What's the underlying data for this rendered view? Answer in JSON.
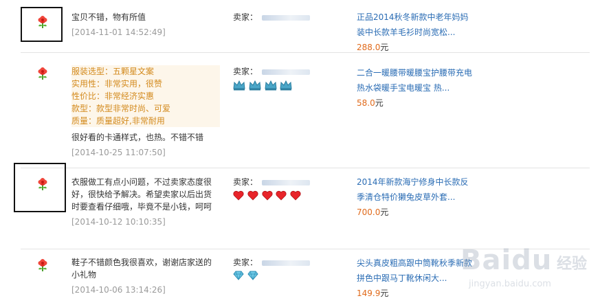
{
  "reviews": [
    {
      "rating_icon": "flower-icon",
      "comment": "宝贝不错，物有所值",
      "date": "[2014-11-01 14:52:49]",
      "seller_label": "卖家：",
      "badges": [],
      "product_title": "正品2014秋冬新款中老年妈妈装中长款羊毛衫时尚宽松...",
      "price": "288.0",
      "currency": "元"
    },
    {
      "rating_icon": "flower-icon",
      "attributes": [
        "服装选型：五颗星文案",
        "实用性：非常实用，很赞",
        "性价比：非常经济实惠",
        "款型：款型非常时尚、可爱",
        "质量：质量超好,非常耐用"
      ],
      "comment": "很好看的卡通样式，也热。不错不错",
      "date": "[2014-10-25 11:07:50]",
      "seller_label": "卖家：",
      "badge_type": "crown-icon",
      "badges": [
        "crown",
        "crown",
        "crown",
        "crown"
      ],
      "product_title": "二合一暖腰带暖腰宝护腰带充电热水袋暖手宝电暖宝 热...",
      "price": "58.0",
      "currency": "元"
    },
    {
      "rating_icon": "flower-icon",
      "comment": "衣服做工有点小问题，不过卖家态度很好，很快给予解决。希望卖家以后出货时要查看仔细哦，毕竟不是小钱，呵呵",
      "date": "[2014-10-12 10:10:35]",
      "seller_label": "卖家：",
      "badge_type": "heart-icon",
      "badges": [
        "heart",
        "heart",
        "heart",
        "heart",
        "heart"
      ],
      "product_title": "2014年新款海宁修身中长款反季清仓特价獭兔皮草外套...",
      "price": "700.0",
      "currency": "元"
    },
    {
      "rating_icon": "flower-icon",
      "comment": "鞋子不错颜色我很喜欢，谢谢店家送的小礼物",
      "date": "[2014-10-06 13:14:26]",
      "seller_label": "卖家：",
      "badge_type": "diamond-icon",
      "badges": [
        "diamond",
        "diamond"
      ],
      "product_title": "尖头真皮粗高跟中筒靴秋季新款拼色中跟马丁靴休闲大...",
      "price": "149.9",
      "currency": "元"
    }
  ],
  "watermark": {
    "logo": "Baidu",
    "cn": "经验",
    "url": "jingyan.baidu.com"
  },
  "colors": {
    "link": "#2a6cb4",
    "price": "#e06a1b",
    "attribute": "#d38a1d",
    "date": "#9a9a9a"
  }
}
